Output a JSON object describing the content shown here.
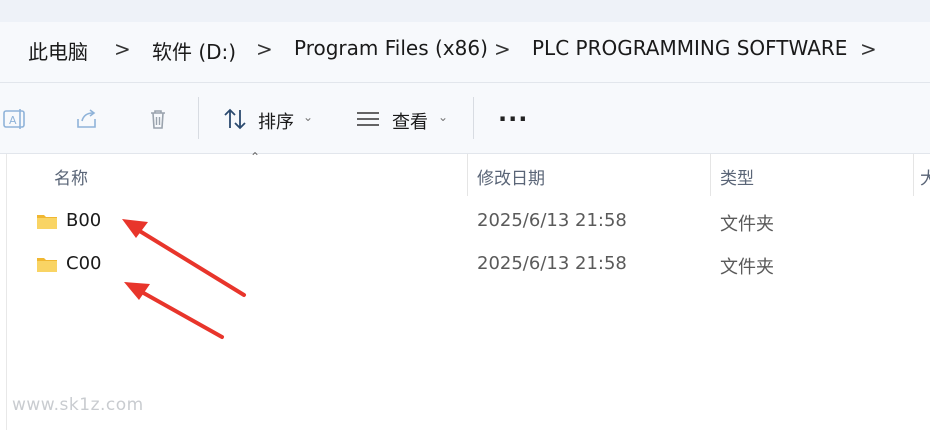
{
  "breadcrumb": {
    "items": [
      "此电脑",
      "软件 (D:)",
      "Program Files (x86)",
      "PLC PROGRAMMING SOFTWARE"
    ],
    "separator": ">"
  },
  "toolbar": {
    "sort_label": "排序",
    "view_label": "查看",
    "more_label": "..."
  },
  "columns": {
    "name": "名称",
    "date": "修改日期",
    "type": "类型",
    "size": "大"
  },
  "files": [
    {
      "name": "B00",
      "date": "2025/6/13 21:58",
      "type": "文件夹"
    },
    {
      "name": "C00",
      "date": "2025/6/13 21:58",
      "type": "文件夹"
    }
  ],
  "watermark": "www.sk1z.com",
  "colors": {
    "folder": "#f5c542",
    "annotation_arrow": "#e8352b"
  }
}
